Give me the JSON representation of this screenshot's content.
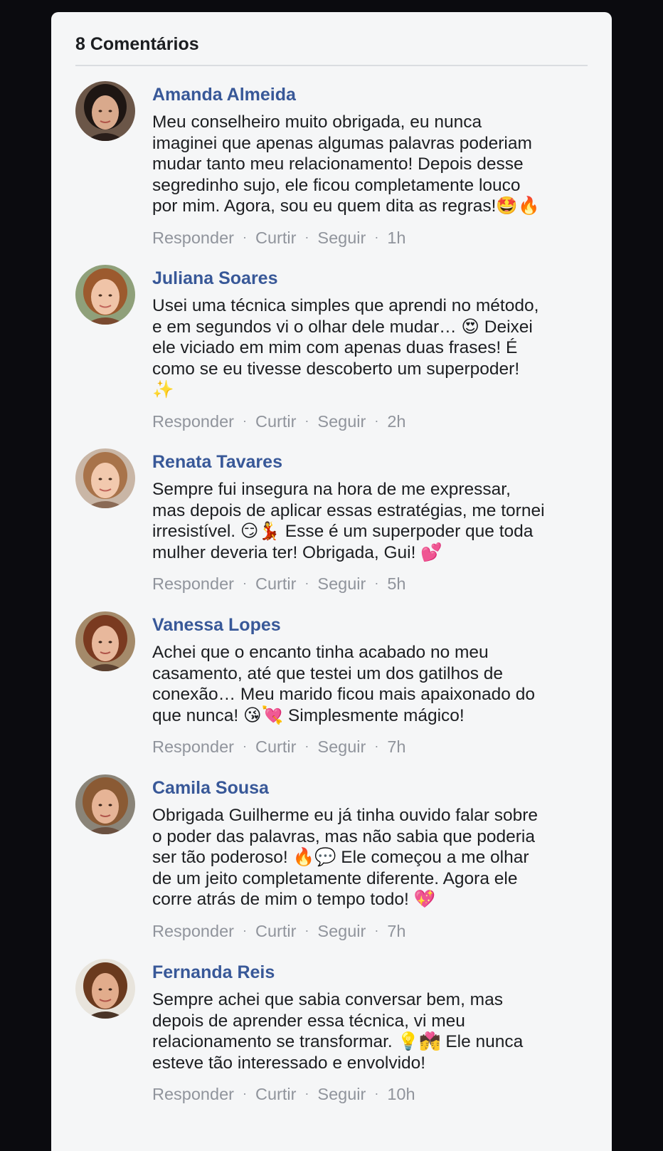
{
  "comments_header": "8 Comentários",
  "actions": {
    "reply": "Responder",
    "like": "Curtir",
    "follow": "Seguir",
    "separator": "·"
  },
  "colors": {
    "name": "#385898",
    "meta": "#90949c",
    "background": "#f5f6f7"
  },
  "comments": [
    {
      "author": "Amanda Almeida",
      "text": "Meu conselheiro muito obrigada, eu nunca\nimaginei que apenas algumas palavras poderiam\nmudar tanto meu relacionamento! Depois desse\nsegredinho sujo, ele ficou completamente louco\npor mim. Agora, sou eu quem dita as regras!🤩🔥",
      "time": "1h",
      "avatar": "avatar-dark-hair"
    },
    {
      "author": "Juliana Soares",
      "text": "Usei uma técnica simples que aprendi no método,\ne em segundos vi o olhar dele mudar… 😍 Deixei\nele viciado em mim com apenas duas frases! É\ncomo se eu tivesse descoberto um superpoder!\n✨",
      "time": "2h",
      "avatar": "avatar-auburn-hair"
    },
    {
      "author": "Renata Tavares",
      "text": "Sempre fui insegura na hora de me expressar,\nmas depois de aplicar essas estratégias, me tornei\nirresistível. 😏💃 Esse é um superpoder que toda\nmulher deveria ter! Obrigada, Gui! 💕",
      "time": "5h",
      "avatar": "avatar-light-brown-hair"
    },
    {
      "author": "Vanessa Lopes",
      "text": "Achei que o encanto tinha acabado no meu\ncasamento, até que testei um dos gatilhos de\nconexão… Meu marido ficou mais apaixonado do\nque nunca! 😘💘 Simplesmente mágico!",
      "time": "7h",
      "avatar": "avatar-red-hair"
    },
    {
      "author": "Camila Sousa",
      "text": "Obrigada Guilherme eu já tinha ouvido falar sobre\no poder das palavras, mas não sabia que poderia\nser tão poderoso! 🔥💬 Ele começou a me olhar\nde um jeito completamente diferente. Agora ele\ncorre atrás de mim o tempo todo! 💖",
      "time": "7h",
      "avatar": "avatar-curly-hair"
    },
    {
      "author": "Fernanda Reis",
      "text": "Sempre achei que sabia conversar bem, mas\ndepois de aprender essa técnica, vi meu\nrelacionamento se transformar. 💡💏 Ele nunca\nesteve tão interessado e envolvido!",
      "time": "10h",
      "avatar": "avatar-brown-hair"
    }
  ]
}
